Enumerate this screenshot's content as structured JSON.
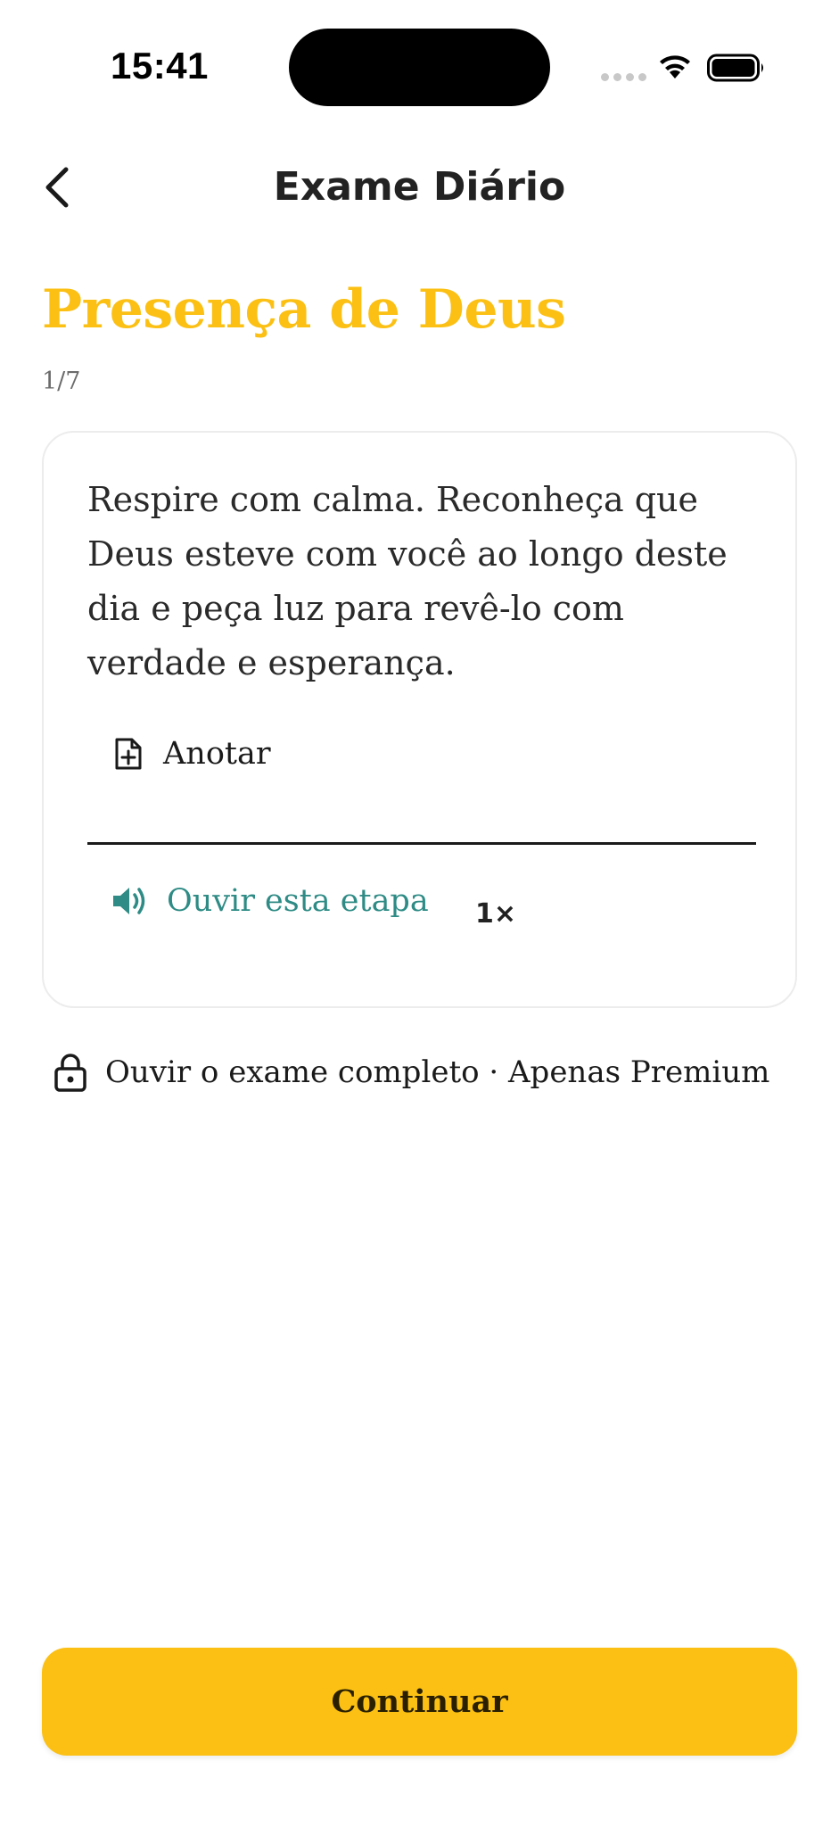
{
  "status_bar": {
    "time": "15:41"
  },
  "header": {
    "title": "Exame Diário",
    "back_icon": "chevron-left-icon"
  },
  "step": {
    "title": "Presença de Deus",
    "counter": "1/7",
    "title_color": "#FBC013"
  },
  "card": {
    "text": "Respire com calma. Reconheça que Deus esteve com você ao longo deste dia e peça luz para revê-lo com verdade e esperança.",
    "note_label": "Anotar",
    "note_icon": "file-plus-icon",
    "listen_label": "Ouvir esta etapa",
    "listen_icon": "speaker-icon",
    "listen_color": "#2E8B85",
    "speed": "1×"
  },
  "premium": {
    "label": "Ouvir o exame completo · Apenas Premium",
    "icon": "lock-icon"
  },
  "footer": {
    "continue_label": "Continuar",
    "button_color": "#FBC013"
  }
}
